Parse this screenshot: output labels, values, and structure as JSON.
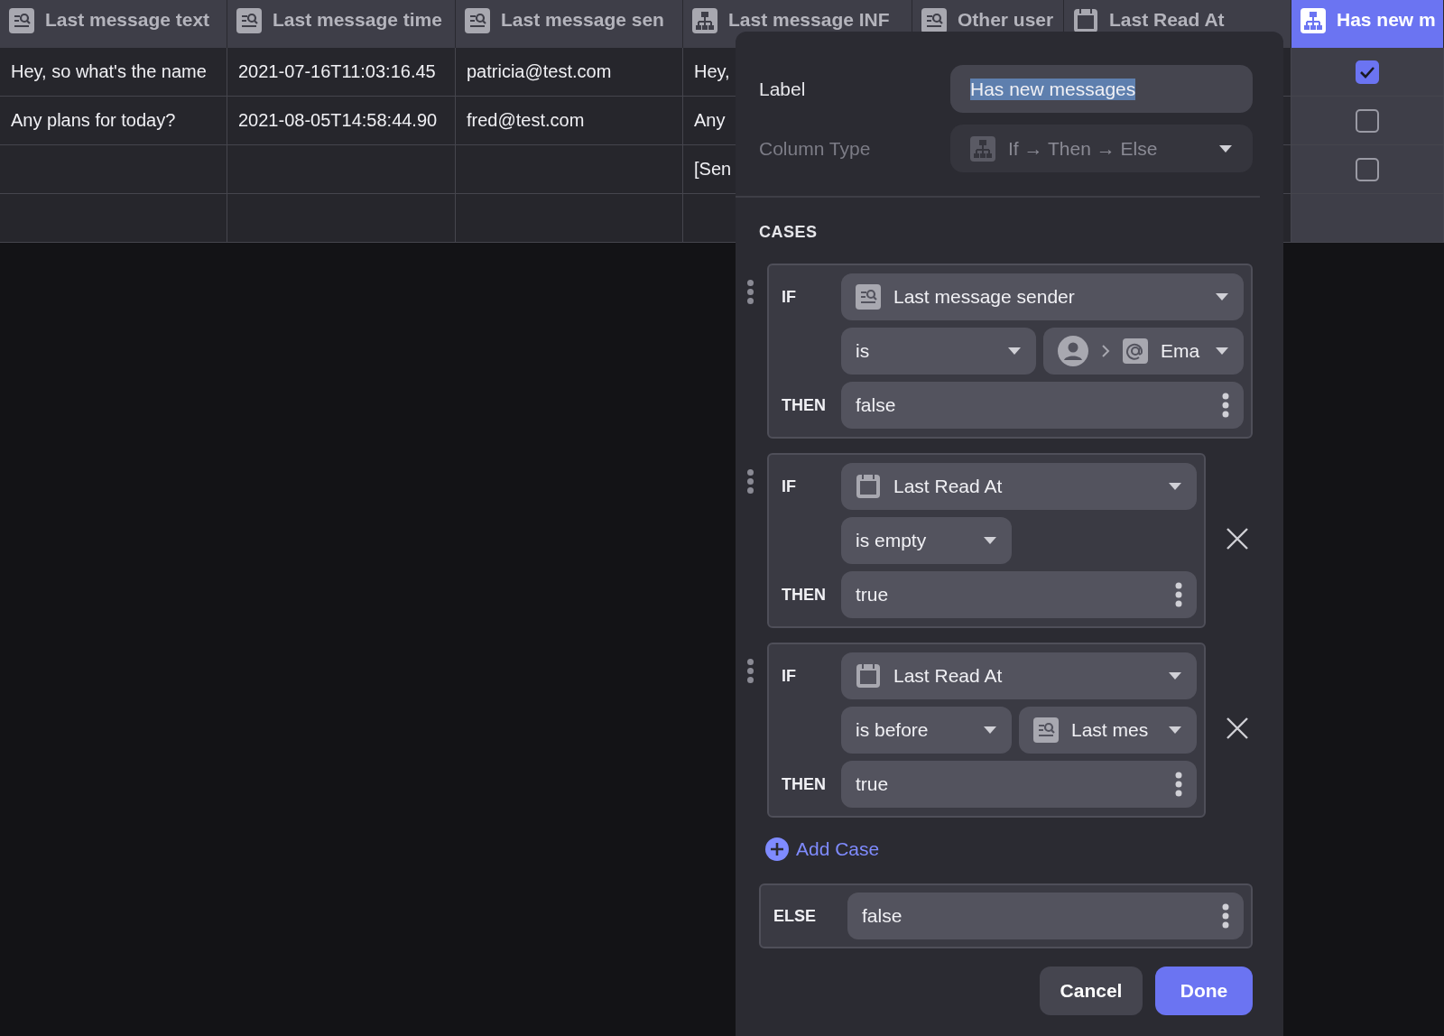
{
  "table": {
    "columns": [
      {
        "label": "Last message text",
        "kind": "lookup",
        "selected": false
      },
      {
        "label": "Last message time",
        "kind": "lookup",
        "selected": false
      },
      {
        "label": "Last message sen",
        "kind": "lookup",
        "selected": false
      },
      {
        "label": "Last message INF",
        "kind": "formula",
        "selected": false
      },
      {
        "label": "Other user",
        "kind": "lookup",
        "selected": false
      },
      {
        "label": "Last Read At",
        "kind": "date",
        "selected": false
      },
      {
        "label": "Has new m",
        "kind": "formula",
        "selected": true
      }
    ],
    "rows": [
      {
        "cells": [
          "Hey, so what's the name",
          "2021-07-16T11:03:16.45",
          "patricia@test.com",
          "Hey,",
          null,
          null
        ],
        "checked": true
      },
      {
        "cells": [
          "Any plans for today?",
          "2021-08-05T14:58:44.90",
          "fred@test.com",
          "Any",
          null,
          null
        ],
        "checked": false
      },
      {
        "cells": [
          null,
          null,
          null,
          "[Sen",
          null,
          null
        ],
        "checked": false
      },
      {
        "cells": [
          null,
          null,
          null,
          null,
          null,
          null
        ]
      }
    ]
  },
  "editor": {
    "label_field": {
      "label": "Label",
      "value": "Has new messages",
      "text_selected": true
    },
    "type_field": {
      "label": "Column Type",
      "value": "If → Then → Else",
      "kind": "formula",
      "disabled": true
    },
    "cases_heading": "CASES",
    "cases": [
      {
        "if_label": "IF",
        "field": {
          "kind": "lookup",
          "text": "Last message sender"
        },
        "operator": "is",
        "operand": {
          "kind": "path",
          "text": "Ema"
        },
        "then_label": "THEN",
        "then_value": "false",
        "removable": false
      },
      {
        "if_label": "IF",
        "field": {
          "kind": "date",
          "text": "Last Read At"
        },
        "operator": "is empty",
        "then_label": "THEN",
        "then_value": "true",
        "removable": true
      },
      {
        "if_label": "IF",
        "field": {
          "kind": "date",
          "text": "Last Read At"
        },
        "operator": "is before",
        "operand": {
          "kind": "lookup",
          "text": "Last mes"
        },
        "then_label": "THEN",
        "then_value": "true",
        "removable": true
      }
    ],
    "add_case": "Add Case",
    "else": {
      "label": "ELSE",
      "value": "false"
    },
    "buttons": [
      {
        "label": "Cancel",
        "kind": "secondary"
      },
      {
        "label": "Done",
        "kind": "primary"
      }
    ]
  }
}
